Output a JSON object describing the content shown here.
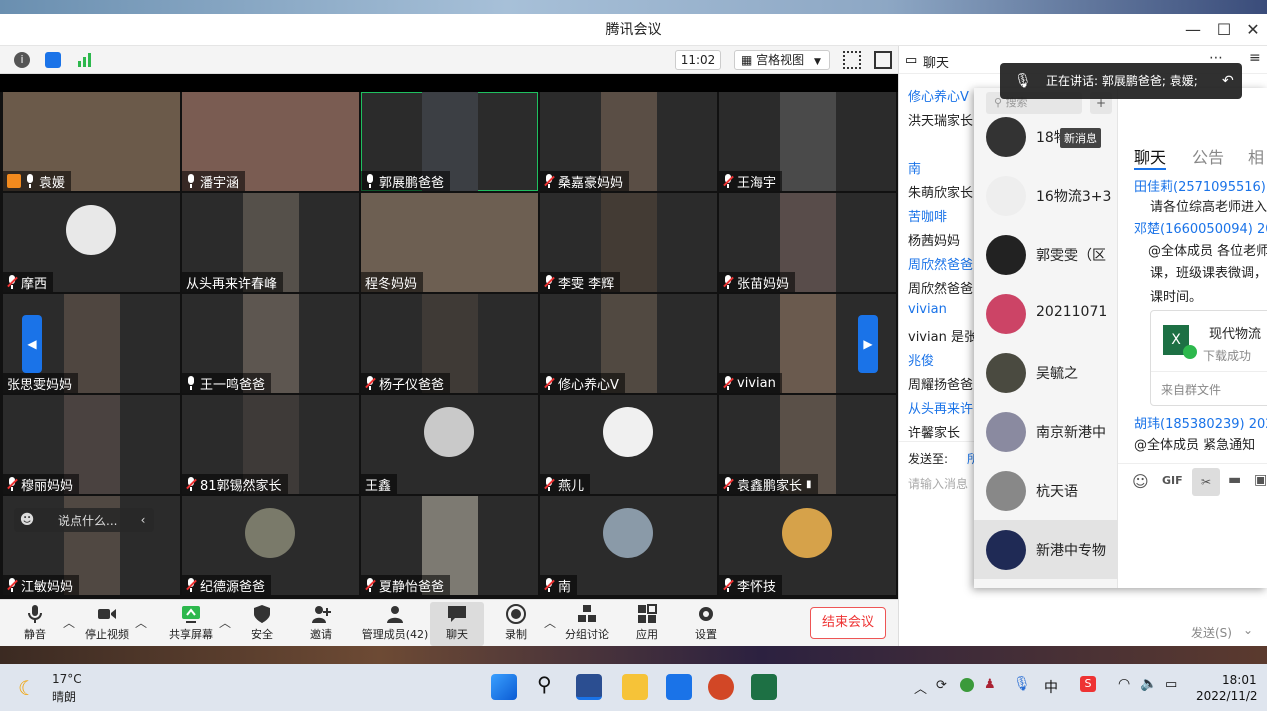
{
  "window": {
    "title": "腾讯会议"
  },
  "topbar": {
    "time": "11:02",
    "view_label": "宫格视图"
  },
  "tiles": [
    {
      "name": "袁媛",
      "mic": "on"
    },
    {
      "name": "潘宇涵",
      "mic": "on"
    },
    {
      "name": "郭展鹏爸爸",
      "mic": "on"
    },
    {
      "name": "桑嘉豪妈妈",
      "mic": "muted"
    },
    {
      "name": "王海宇",
      "mic": "muted"
    },
    {
      "name": "摩西",
      "mic": "muted"
    },
    {
      "name": "从头再来许春峰",
      "mic": "none"
    },
    {
      "name": "程冬妈妈",
      "mic": "none"
    },
    {
      "name": "李雯 李辉",
      "mic": "muted"
    },
    {
      "name": "张苗妈妈",
      "mic": "muted"
    },
    {
      "name": "张思雯妈妈",
      "mic": "none"
    },
    {
      "name": "王一鸣爸爸",
      "mic": "on"
    },
    {
      "name": "杨子仪爸爸",
      "mic": "muted"
    },
    {
      "name": "修心养心V",
      "mic": "muted"
    },
    {
      "name": "vivian",
      "mic": "muted"
    },
    {
      "name": "穆丽妈妈",
      "mic": "muted"
    },
    {
      "name": "81郭锡然家长",
      "mic": "muted"
    },
    {
      "name": "王鑫",
      "mic": "none"
    },
    {
      "name": "燕儿",
      "mic": "muted"
    },
    {
      "name": "袁鑫鹏家长",
      "mic": "muted"
    },
    {
      "name": "江敏妈妈",
      "mic": "muted"
    },
    {
      "name": "纪德源爸爸",
      "mic": "muted"
    },
    {
      "name": "夏静怡爸爸",
      "mic": "muted"
    },
    {
      "name": "南",
      "mic": "muted"
    },
    {
      "name": "李怀技",
      "mic": "muted"
    }
  ],
  "chat_hint": "说点什么...",
  "toolbar": {
    "mute": "静音",
    "stop_video": "停止视频",
    "share": "共享屏幕",
    "security": "安全",
    "invite": "邀请",
    "members": "管理成员(42)",
    "chat": "聊天",
    "record": "录制",
    "breakout": "分组讨论",
    "apps": "应用",
    "settings": "设置",
    "end": "结束会议"
  },
  "chat": {
    "title": "聊天",
    "lines": [
      {
        "text": "修心养心V",
        "type": "name"
      },
      {
        "text": "洪天瑞家长",
        "type": "msg"
      },
      {
        "text": "南",
        "type": "name"
      },
      {
        "text": "朱萌欣家长",
        "type": "msg"
      },
      {
        "text": "苦咖啡",
        "type": "name"
      },
      {
        "text": "杨茜妈妈",
        "type": "msg"
      },
      {
        "text": "周欣然爸爸",
        "type": "name"
      },
      {
        "text": "周欣然爸爸",
        "type": "msg"
      },
      {
        "text": "vivian",
        "type": "name"
      },
      {
        "text": "vivian 是张",
        "type": "msg"
      },
      {
        "text": "兆俊",
        "type": "name"
      },
      {
        "text": "周耀扬爸爸",
        "type": "msg"
      },
      {
        "text": "从头再来许",
        "type": "name"
      },
      {
        "text": "许馨家长",
        "type": "msg"
      }
    ],
    "send_to_label": "发送至:",
    "send_to_value": "所",
    "input_placeholder": "请输入消息",
    "send_button": "发送(S)"
  },
  "speaking_banner": "正在讲话: 郭展鹏爸爸; 袁媛;",
  "qq": {
    "search_placeholder": "搜索",
    "new_msg_tip": "新消息",
    "contacts": [
      "18物流",
      "16物流3+3",
      "郭雯雯（区",
      "20211071",
      "吴毓之",
      "南京新港中",
      "杭天语",
      "新港中专物"
    ],
    "tabs": [
      "聊天",
      "公告",
      "相"
    ],
    "messages": [
      {
        "text": "田佳莉(2571095516) 20",
        "color": "#1a73e8"
      },
      {
        "text": "请各位综高老师进入",
        "color": "#222"
      },
      {
        "text": "邓楚(1660050094) 2022",
        "color": "#1a73e8"
      },
      {
        "text": "@全体成员 各位老师",
        "color": "#222"
      },
      {
        "text": "课，班级课表微调，",
        "color": "#222"
      },
      {
        "text": "课时间。",
        "color": "#222"
      }
    ],
    "file_name": "现代物流",
    "file_status": "下载成功",
    "file_source": "来自群文件",
    "msg2_head": "胡玮(185380239) 2022/",
    "msg2_body": "@全体成员 紧急通知"
  },
  "taskbar": {
    "temp": "17°C",
    "weather": "晴朗",
    "ime": "中",
    "clock_time": "18:01",
    "clock_date": "2022/11/2"
  }
}
